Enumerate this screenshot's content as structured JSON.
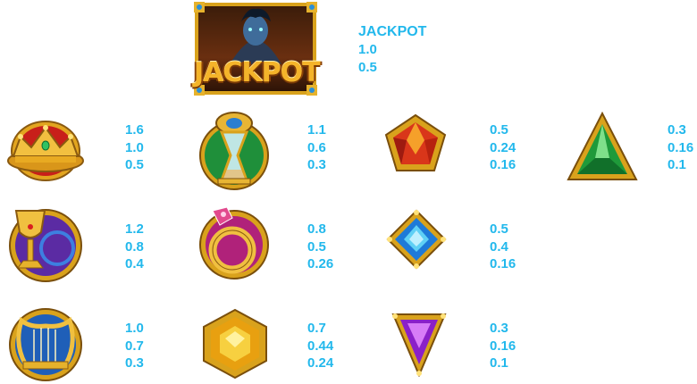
{
  "jackpot": {
    "badge_text": "JACKPOT",
    "label": "JACKPOT",
    "values": [
      "1.0",
      "0.5"
    ]
  },
  "paytable": {
    "crown": {
      "icon": "crown-icon",
      "values": [
        "1.6",
        "1.0",
        "0.5"
      ]
    },
    "hourglass": {
      "icon": "hourglass-icon",
      "values": [
        "1.1",
        "0.6",
        "0.3"
      ]
    },
    "red_gem": {
      "icon": "red-pentagon-gem-icon",
      "values": [
        "0.5",
        "0.24",
        "0.16"
      ]
    },
    "green_gem": {
      "icon": "green-triangle-gem-icon",
      "values": [
        "0.3",
        "0.16",
        "0.1"
      ]
    },
    "chalice": {
      "icon": "chalice-icon",
      "values": [
        "1.2",
        "0.8",
        "0.4"
      ]
    },
    "ring": {
      "icon": "ring-icon",
      "values": [
        "0.8",
        "0.5",
        "0.26"
      ]
    },
    "blue_gem": {
      "icon": "blue-diamond-gem-icon",
      "values": [
        "0.5",
        "0.4",
        "0.16"
      ]
    },
    "lyre": {
      "icon": "lyre-icon",
      "values": [
        "1.0",
        "0.7",
        "0.3"
      ]
    },
    "yellow_gem": {
      "icon": "yellow-hexagon-gem-icon",
      "values": [
        "0.7",
        "0.44",
        "0.24"
      ]
    },
    "purple_gem": {
      "icon": "purple-triangle-gem-icon",
      "values": [
        "0.3",
        "0.16",
        "0.1"
      ]
    }
  },
  "colors": {
    "value_text": "#22b8ec",
    "gold": "#d9a21c",
    "jackpot_bg": "#2b1508"
  }
}
